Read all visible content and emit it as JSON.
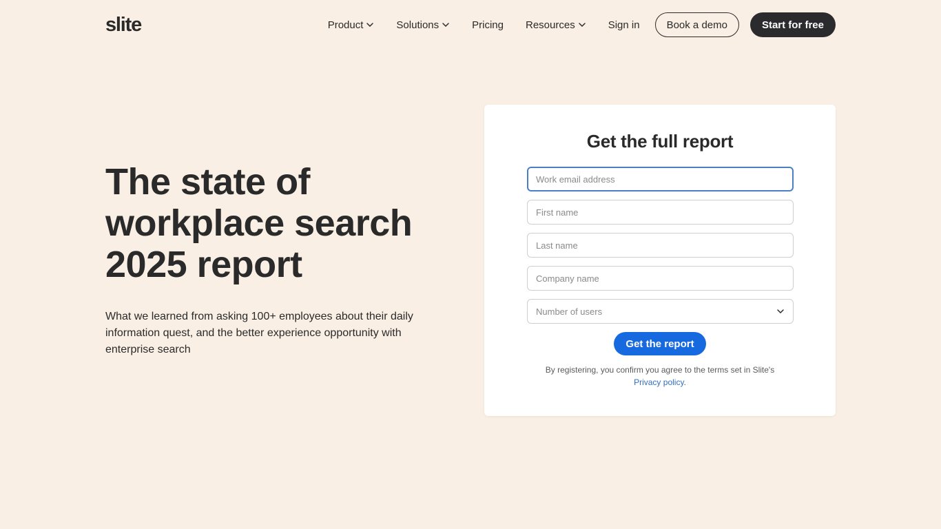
{
  "header": {
    "logo": "slite",
    "nav": [
      {
        "label": "Product",
        "has_dropdown": true
      },
      {
        "label": "Solutions",
        "has_dropdown": true
      },
      {
        "label": "Pricing",
        "has_dropdown": false
      },
      {
        "label": "Resources",
        "has_dropdown": true
      },
      {
        "label": "Sign in",
        "has_dropdown": false
      }
    ],
    "book_demo_label": "Book a demo",
    "start_free_label": "Start for free"
  },
  "hero": {
    "title": "The state of workplace search 2025 report",
    "subtitle": "What we learned from asking 100+ employees about their daily information quest, and the better experience opportunity with enterprise search"
  },
  "form": {
    "title": "Get the full report",
    "fields": {
      "email": {
        "placeholder": "Work email address",
        "value": ""
      },
      "first_name": {
        "placeholder": "First name",
        "value": ""
      },
      "last_name": {
        "placeholder": "Last name",
        "value": ""
      },
      "company": {
        "placeholder": "Company name",
        "value": ""
      }
    },
    "users_select": {
      "selected": "Number of users"
    },
    "submit_label": "Get the report",
    "legal_text": "By registering, you confirm you agree to the terms set in Slite's",
    "privacy_link": "Privacy policy",
    "legal_end": "."
  },
  "colors": {
    "background": "#f9efe4",
    "primary_button": "#1769e0",
    "dark_button": "#2b2b2e",
    "link": "#2e6fc7"
  },
  "icons": {
    "dropdown": "chevron-down-icon"
  }
}
